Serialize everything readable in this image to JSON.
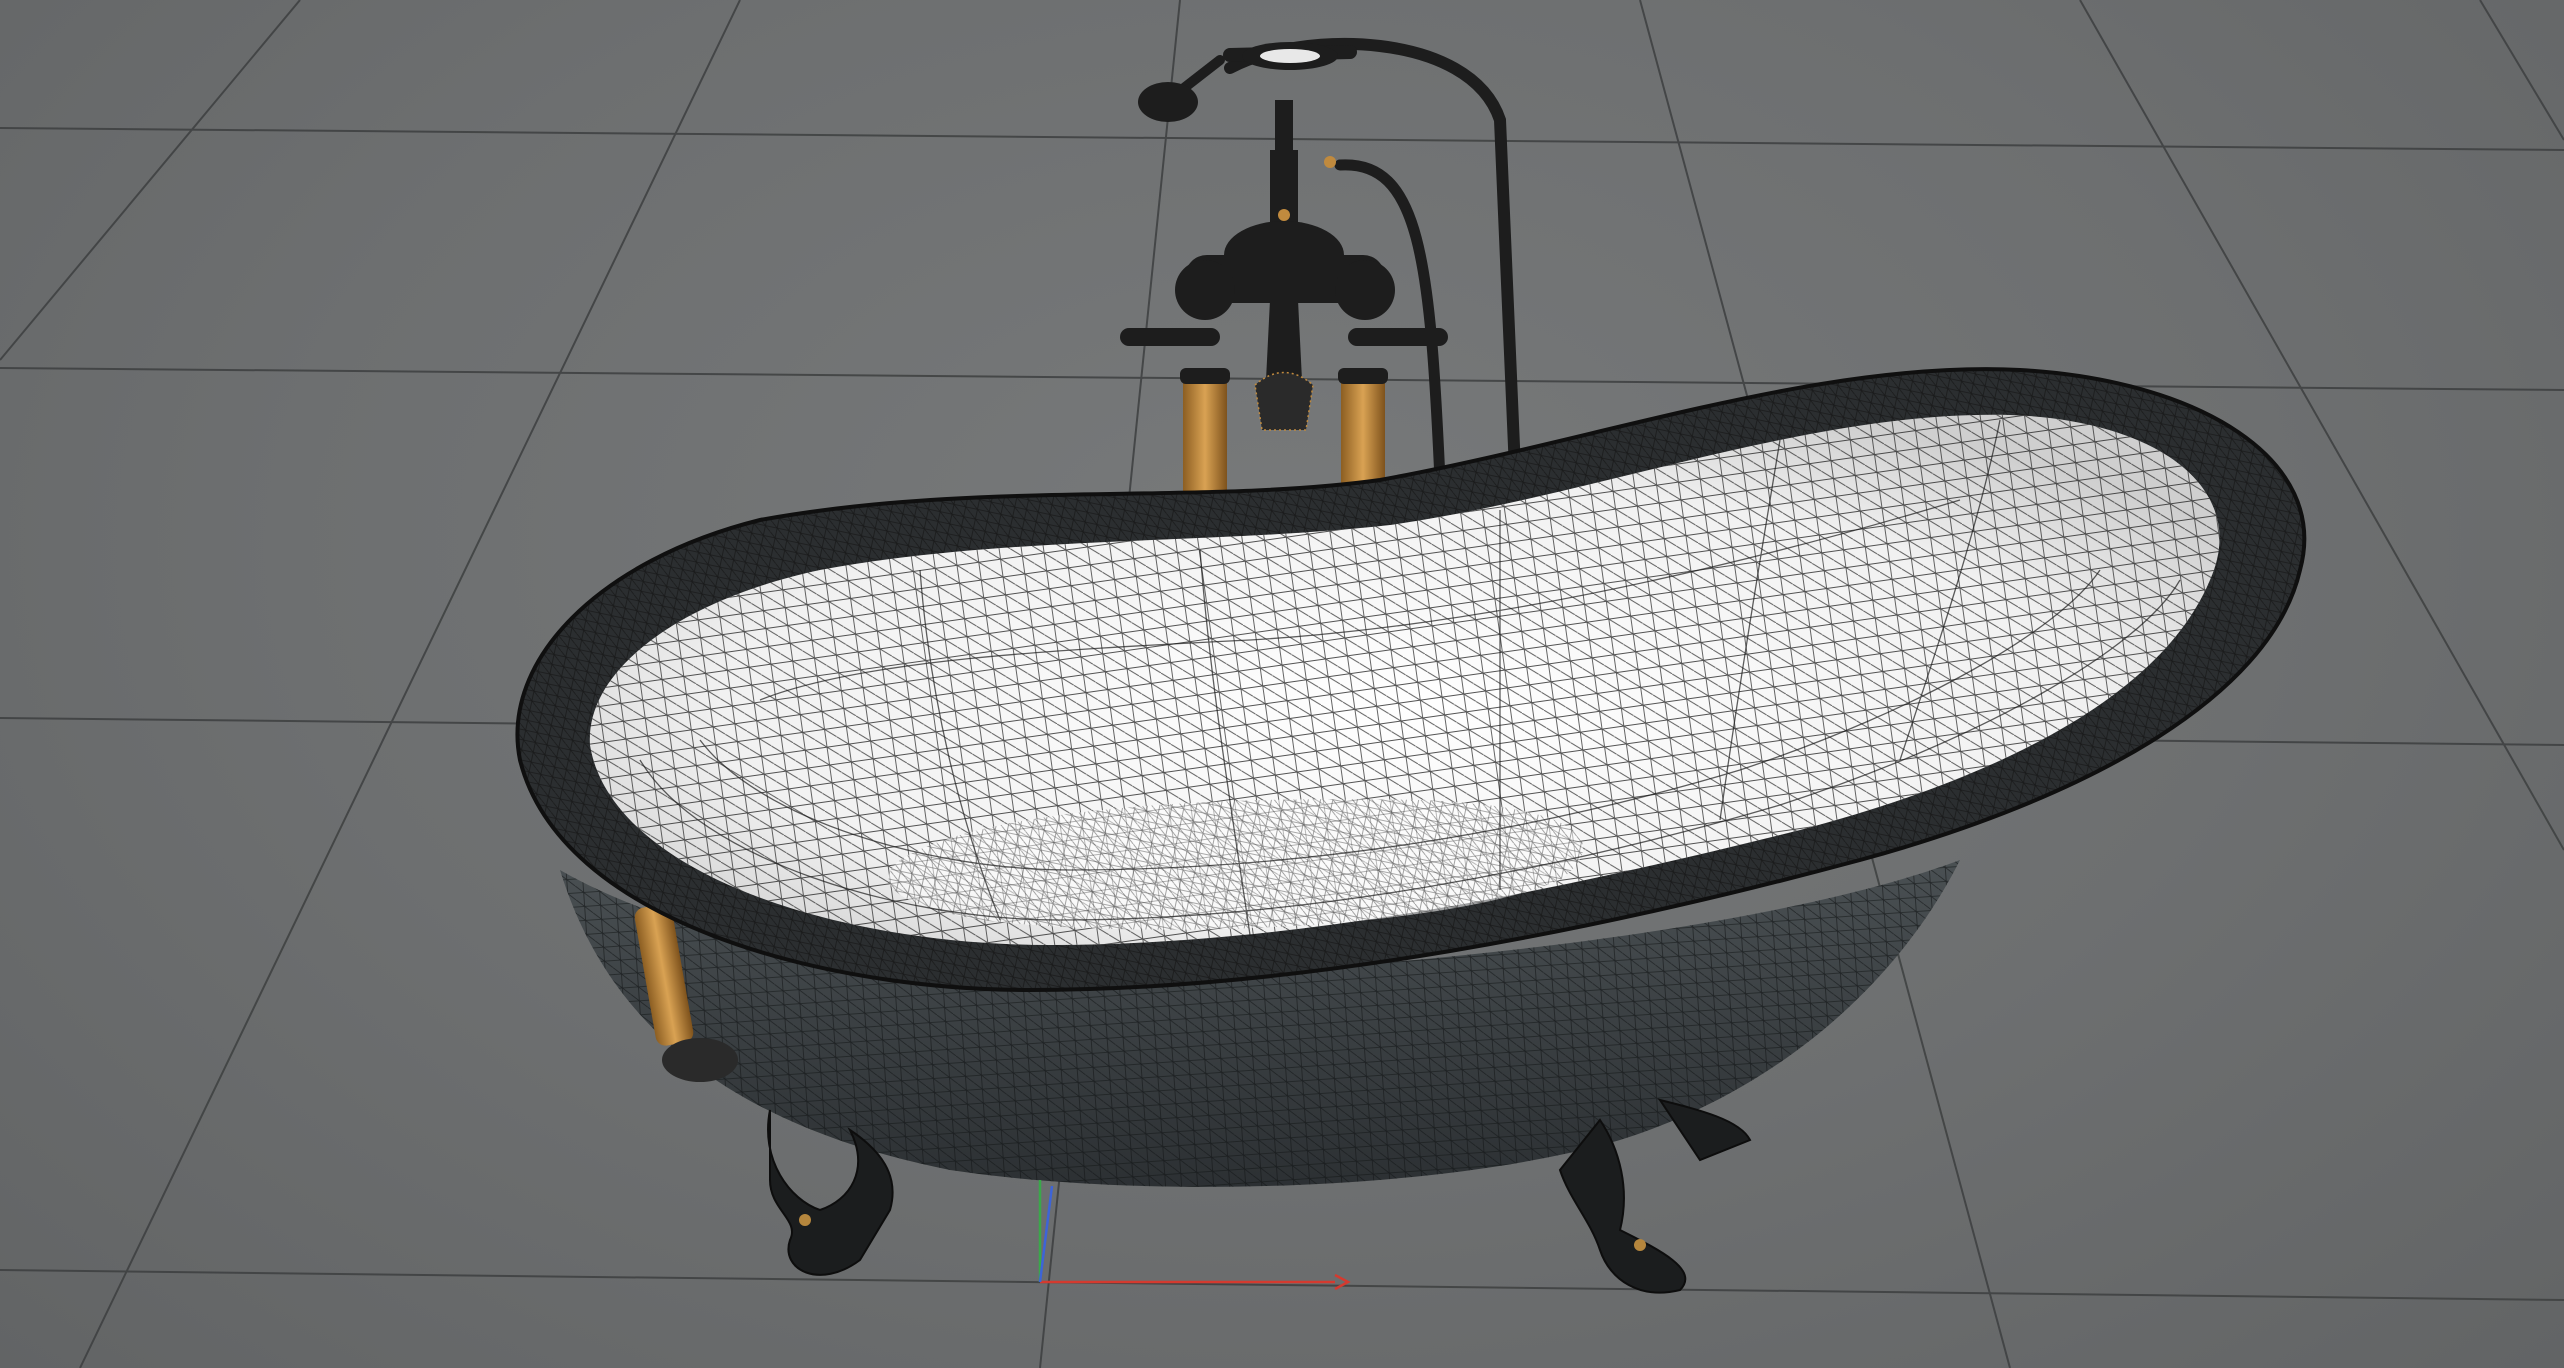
{
  "viewport": {
    "mode": "wireframe-on-shaded",
    "background_color": "#6b6d6e",
    "grid_color": "#3d3f40",
    "grid": "on"
  },
  "scene": {
    "object": "clawfoot-bathtub",
    "parts": [
      "tub-body",
      "tub-interior",
      "tub-rim",
      "claw-feet",
      "tub-filler-faucet",
      "hand-shower",
      "overflow-drain"
    ],
    "colors": {
      "interior": "#f4f4f4",
      "exterior": "#3a3f42",
      "wire": "#1b1b1b",
      "brass": "#c08a3e",
      "black_metal": "#1d1d1d"
    }
  },
  "gizmo": {
    "x_axis_color": "#d43a2f",
    "y_axis_color": "#3aa84a",
    "z_axis_color": "#3d64d8"
  }
}
